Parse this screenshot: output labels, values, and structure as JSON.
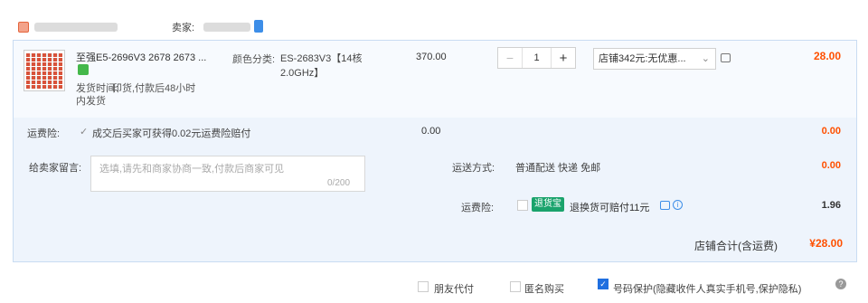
{
  "shop": {
    "seller_label": "卖家:"
  },
  "product": {
    "title": "至强E5-2696V3 2678 2673 ...",
    "ship_label": "发货时间:",
    "ship_text": "印货,付款后48小时",
    "ship_text2": "内发货",
    "spec_label": "颜色分类:",
    "spec_value": "ES-2683V3【14核2.0GHz】",
    "price": "370.00",
    "quantity": "1",
    "minus": "−",
    "plus": "+",
    "coupon": "店铺342元:无优惠...",
    "subtotal": "28.00"
  },
  "shipping_insurance": {
    "label": "运费险:",
    "check": "✓",
    "text": "成交后买家可获得0.02元运费险赔付",
    "price": "0.00",
    "total": "0.00"
  },
  "message": {
    "label": "给卖家留言:",
    "placeholder": "选填,请先和商家协商一致,付款后商家可见",
    "count": "0/200"
  },
  "delivery": {
    "label": "运送方式:",
    "value": "普通配送 快递 免邮",
    "price": "0.00"
  },
  "insurance": {
    "label": "运费险:",
    "badge": "退货宝",
    "text": "退换货可赔付11元",
    "info": "i",
    "price": "1.96"
  },
  "shop_total": {
    "label": "店铺合计(含运费)",
    "value": "¥28.00"
  },
  "footer": {
    "opt1": "朋友代付",
    "opt2": "匿名购买",
    "opt3": "号码保护(隐藏收件人真实手机号,保护隐私)",
    "check_mark": "✓",
    "help": "?"
  },
  "colors": {
    "price_accent": "#ff5000",
    "box_bg": "#eef4fc",
    "insurance_badge": "#1aa36c",
    "checkbox_checked": "#1f6fe0"
  }
}
